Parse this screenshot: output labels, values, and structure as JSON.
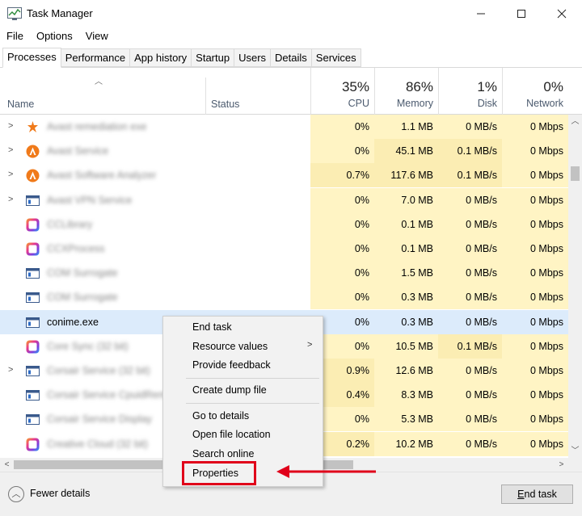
{
  "window": {
    "title": "Task Manager"
  },
  "menu": [
    "File",
    "Options",
    "View"
  ],
  "tabs": [
    {
      "label": "Processes",
      "active": true
    },
    {
      "label": "Performance"
    },
    {
      "label": "App history"
    },
    {
      "label": "Startup"
    },
    {
      "label": "Users"
    },
    {
      "label": "Details"
    },
    {
      "label": "Services"
    }
  ],
  "columns": {
    "name": "Name",
    "status": "Status",
    "cpu": {
      "pct": "35%",
      "label": "CPU"
    },
    "memory": {
      "pct": "86%",
      "label": "Memory"
    },
    "disk": {
      "pct": "1%",
      "label": "Disk"
    },
    "network": {
      "pct": "0%",
      "label": "Network"
    }
  },
  "rows": [
    {
      "name": "Avast remediation exe",
      "blurred": true,
      "icon": "avast-remediation-icon",
      "expandable": true,
      "cpu": "0%",
      "memory": "1.1 MB",
      "disk": "0 MB/s",
      "network": "0 Mbps"
    },
    {
      "name": "Avast Service",
      "blurred": true,
      "icon": "avast-icon",
      "expandable": true,
      "cpu": "0%",
      "memory": "45.1 MB",
      "disk": "0.1 MB/s",
      "network": "0 Mbps"
    },
    {
      "name": "Avast Software Analyzer",
      "blurred": true,
      "icon": "avast-icon",
      "expandable": true,
      "cpu": "0.7%",
      "memory": "117.6 MB",
      "disk": "0.1 MB/s",
      "network": "0 Mbps"
    },
    {
      "name": "Avast VPN Service",
      "blurred": true,
      "icon": "window-app-icon",
      "expandable": true,
      "cpu": "0%",
      "memory": "7.0 MB",
      "disk": "0 MB/s",
      "network": "0 Mbps"
    },
    {
      "name": "CCLibrary",
      "blurred": true,
      "icon": "creative-cloud-icon",
      "expandable": false,
      "cpu": "0%",
      "memory": "0.1 MB",
      "disk": "0 MB/s",
      "network": "0 Mbps"
    },
    {
      "name": "CCXProcess",
      "blurred": true,
      "icon": "creative-cloud-icon",
      "expandable": false,
      "cpu": "0%",
      "memory": "0.1 MB",
      "disk": "0 MB/s",
      "network": "0 Mbps"
    },
    {
      "name": "COM Surrogate",
      "blurred": true,
      "icon": "window-app-icon",
      "expandable": false,
      "cpu": "0%",
      "memory": "1.5 MB",
      "disk": "0 MB/s",
      "network": "0 Mbps"
    },
    {
      "name": "COM Surrogate",
      "blurred": true,
      "icon": "window-app-icon",
      "expandable": false,
      "cpu": "0%",
      "memory": "0.3 MB",
      "disk": "0 MB/s",
      "network": "0 Mbps"
    },
    {
      "name": "conime.exe",
      "blurred": false,
      "selected": true,
      "icon": "window-app-icon",
      "expandable": false,
      "cpu": "0%",
      "memory": "0.3 MB",
      "disk": "0 MB/s",
      "network": "0 Mbps"
    },
    {
      "name": "Core Sync (32 bit)",
      "blurred": true,
      "icon": "creative-cloud-icon",
      "expandable": false,
      "cpu": "0%",
      "memory": "10.5 MB",
      "disk": "0.1 MB/s",
      "network": "0 Mbps"
    },
    {
      "name": "Corsair Service (32 bit)",
      "blurred": true,
      "icon": "window-app-icon",
      "expandable": true,
      "cpu": "0.9%",
      "memory": "12.6 MB",
      "disk": "0 MB/s",
      "network": "0 Mbps"
    },
    {
      "name": "Corsair Service CpuidRem",
      "blurred": true,
      "icon": "window-app-icon",
      "expandable": false,
      "cpu": "0.4%",
      "memory": "8.3 MB",
      "disk": "0 MB/s",
      "network": "0 Mbps"
    },
    {
      "name": "Corsair Service Display",
      "blurred": true,
      "icon": "window-app-icon",
      "expandable": false,
      "cpu": "0%",
      "memory": "5.3 MB",
      "disk": "0 MB/s",
      "network": "0 Mbps"
    },
    {
      "name": "Creative Cloud (32 bit)",
      "blurred": true,
      "icon": "creative-cloud-icon",
      "expandable": false,
      "cpu": "0.2%",
      "memory": "10.2 MB",
      "disk": "0 MB/s",
      "network": "0 Mbps"
    }
  ],
  "context_menu": {
    "items": [
      "End task",
      "Resource values",
      "Provide feedback",
      "Create dump file",
      "Go to details",
      "Open file location",
      "Search online",
      "Properties"
    ],
    "highlighted": "Properties"
  },
  "footer": {
    "fewer_details": "Fewer details",
    "end_task_prefix": "E",
    "end_task_rest": "nd task"
  },
  "colors": {
    "heat_light": "#fff4c4",
    "heat_medium": "#fbedb3",
    "selected_row": "#dcebfb",
    "annotation_red": "#e0001a"
  }
}
